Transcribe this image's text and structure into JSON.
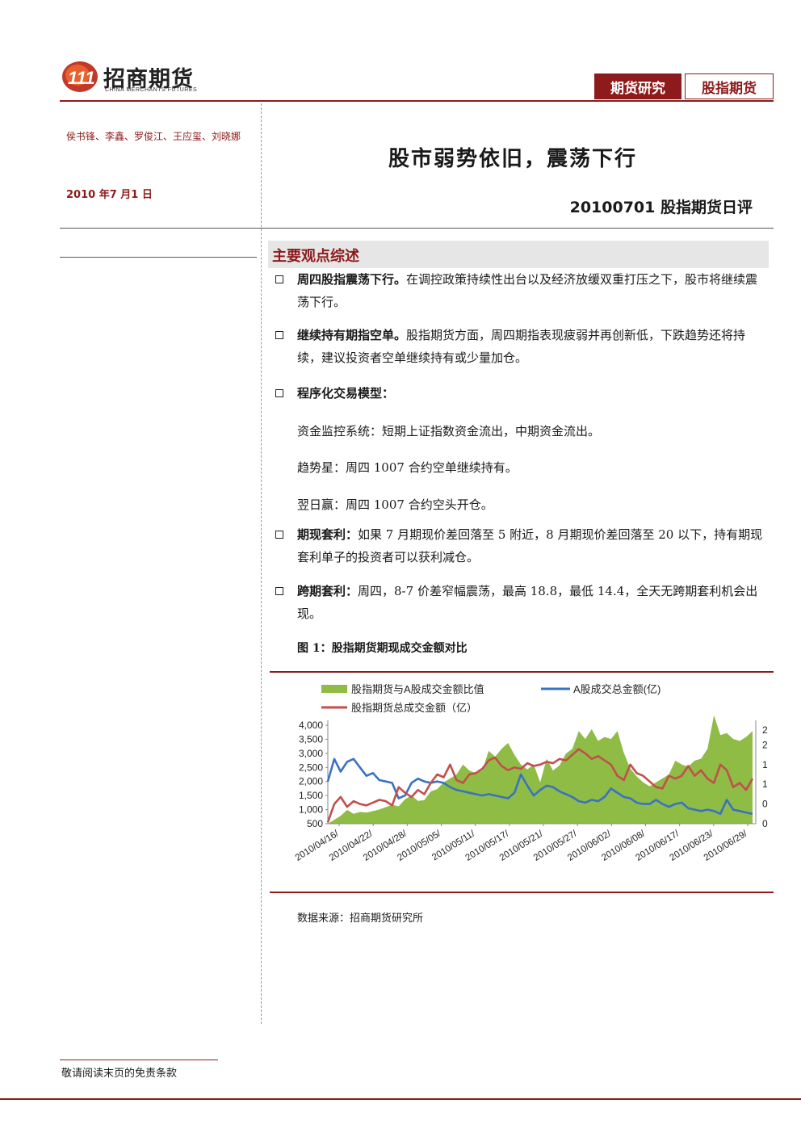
{
  "header": {
    "logo_cn": "招商期货",
    "logo_en": "CHINA MERCHANTS FUTURES",
    "tab_research": "期货研究",
    "tab_category": "股指期货"
  },
  "sidebar": {
    "authors": "侯书锋、李鑫、罗俊江、王应玺、刘晓娜",
    "date": "2010 年7 月1 日"
  },
  "report": {
    "title": "股市弱势依旧，震荡下行",
    "subtitle": "20100701 股指期货日评",
    "section_title": "主要观点综述"
  },
  "points": [
    {
      "head": "周四股指震荡下行。",
      "body": "在调控政策持续性出台以及经济放缓双重打压之下，股市将继续震荡下行。"
    },
    {
      "head": "继续持有期指空单。",
      "body": "股指期货方面，周四期指表现疲弱并再创新低，下跌趋势还将持续，建议投资者空单继续持有或少量加仓。"
    },
    {
      "head": "程序化交易模型：",
      "body": ""
    },
    {
      "head": "期现套利：",
      "body": "如果 7 月期现价差回落至 5 附近，8 月期现价差回落至 20 以下，持有期现套利单子的投资者可以获利减仓。"
    },
    {
      "head": "跨期套利：",
      "body": "周四，8-7 价差窄幅震荡，最高 18.8，最低 14.4，全天无跨期套利机会出现。"
    }
  ],
  "model_lines": [
    "资金监控系统：短期上证指数资金流出，中期资金流出。",
    "趋势星：周四 1007 合约空单继续持有。",
    "翌日赢：周四 1007 合约空头开仓。"
  ],
  "figure": {
    "caption": "图 1：股指期货期现成交金额对比",
    "source": "数据来源：招商期货研究所"
  },
  "footer": {
    "note": "敬请阅读末页的免责条款"
  },
  "colors": {
    "brand": "#8e1b1b",
    "area": "#8fbc45",
    "line_blue": "#3a72c2",
    "line_red": "#c0504d"
  },
  "chart_data": {
    "type": "line",
    "legend": [
      "股指期货与A股成交金额比值",
      "A股成交总金额(亿)",
      "股指期货总成交金额（亿）"
    ],
    "x_tick_labels": [
      "2010/04/16",
      "2010/04/22",
      "2010/04/28",
      "2010/05/05",
      "2010/05/11",
      "2010/05/17",
      "2010/05/21",
      "2010/05/27",
      "2010/06/02",
      "2010/06/08",
      "2010/06/17",
      "2010/06/23",
      "2010/06/29"
    ],
    "y_left": {
      "ticks": [
        "4,000",
        "3,500",
        "3,000",
        "2,500",
        "2,000",
        "1,500",
        "1,000",
        "500"
      ],
      "ylim": [
        500,
        4000
      ]
    },
    "y_right": {
      "ticks": [
        "2",
        "2",
        "1",
        "1",
        "0",
        "0"
      ],
      "ylim": [
        0,
        2.5
      ]
    },
    "series": [
      {
        "name": "股指期货与A股成交金额比值",
        "kind": "area",
        "axis": "right",
        "values": [
          0.0,
          0.1,
          0.2,
          0.35,
          0.25,
          0.3,
          0.28,
          0.32,
          0.36,
          0.42,
          0.48,
          0.44,
          0.62,
          0.72,
          0.58,
          0.6,
          0.82,
          0.88,
          1.05,
          1.15,
          1.25,
          1.5,
          1.35,
          1.28,
          1.35,
          1.85,
          1.7,
          1.9,
          2.05,
          1.75,
          1.5,
          1.38,
          1.5,
          1.05,
          1.65,
          1.35,
          1.48,
          1.78,
          1.9,
          2.35,
          2.15,
          2.4,
          2.1,
          2.2,
          2.15,
          2.35,
          1.8,
          1.4,
          1.2,
          1.05,
          0.95,
          1.05,
          1.15,
          1.25,
          1.6,
          1.5,
          1.45,
          1.6,
          1.65,
          1.9,
          2.75,
          2.25,
          2.3,
          2.15,
          2.1,
          2.2,
          2.35
        ]
      },
      {
        "name": "A股成交总金额(亿)",
        "kind": "line",
        "axis": "left",
        "values": [
          2000,
          2800,
          2350,
          2700,
          2800,
          2500,
          2200,
          2300,
          2050,
          2000,
          1950,
          1400,
          1500,
          1950,
          2100,
          2000,
          1950,
          2000,
          1950,
          1800,
          1700,
          1650,
          1600,
          1550,
          1500,
          1550,
          1500,
          1450,
          1400,
          1600,
          2250,
          1850,
          1500,
          1700,
          1850,
          1800,
          1650,
          1550,
          1450,
          1300,
          1250,
          1350,
          1300,
          1450,
          1750,
          1600,
          1450,
          1400,
          1250,
          1200,
          1200,
          1350,
          1200,
          1100,
          1200,
          1250,
          1050,
          1000,
          950,
          1000,
          950,
          850,
          1350,
          1000,
          950,
          900,
          850
        ]
      },
      {
        "name": "股指期货总成交金额（亿）",
        "kind": "line",
        "axis": "left",
        "values": [
          550,
          1200,
          1450,
          1100,
          1300,
          1200,
          1150,
          1250,
          1350,
          1300,
          1150,
          1800,
          1600,
          1450,
          1700,
          1550,
          1950,
          2250,
          2150,
          2600,
          2050,
          1950,
          2250,
          2300,
          2450,
          2750,
          2850,
          2550,
          2400,
          2500,
          2450,
          2650,
          2550,
          2600,
          2700,
          2650,
          2800,
          2750,
          2950,
          3150,
          3000,
          2800,
          2900,
          2750,
          2600,
          2200,
          2050,
          2600,
          2300,
          2200,
          2000,
          1800,
          1750,
          2200,
          2100,
          2200,
          2550,
          2200,
          2400,
          2100,
          1950,
          2600,
          2400,
          1800,
          1950,
          1700,
          2100
        ]
      }
    ]
  }
}
